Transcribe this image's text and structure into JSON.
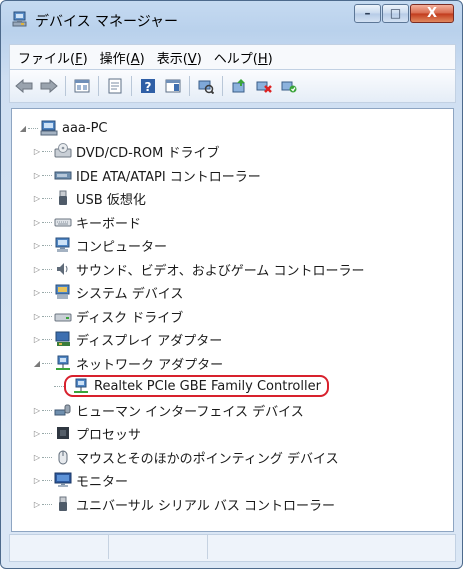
{
  "window": {
    "title": "デバイス マネージャー",
    "caption_buttons": {
      "minimize": "–",
      "maximize": "□",
      "close": "X"
    }
  },
  "menu": {
    "items": [
      {
        "text": "ファイル(",
        "key": "F",
        "end": ")"
      },
      {
        "text": "操作(",
        "key": "A",
        "end": ")"
      },
      {
        "text": "表示(",
        "key": "V",
        "end": ")"
      },
      {
        "text": "ヘルプ(",
        "key": "H",
        "end": ")"
      }
    ]
  },
  "toolbar": {
    "buttons": [
      "back-arrow-icon",
      "forward-arrow-icon",
      "properties-icon",
      "console-tree-icon",
      "help-icon",
      "action-pane-icon",
      "scan-hardware-icon",
      "update-driver-icon",
      "disable-device-icon",
      "uninstall-device-icon"
    ]
  },
  "tree": {
    "root": "aaa-PC",
    "items": [
      {
        "label": "DVD/CD-ROM ドライブ",
        "icon": "dvd-drive-icon",
        "expanded": false
      },
      {
        "label": "IDE ATA/ATAPI コントローラー",
        "icon": "ide-controller-icon",
        "expanded": false
      },
      {
        "label": "USB 仮想化",
        "icon": "usb-icon",
        "expanded": false
      },
      {
        "label": "キーボード",
        "icon": "keyboard-icon",
        "expanded": false
      },
      {
        "label": "コンピューター",
        "icon": "computer-icon",
        "expanded": false
      },
      {
        "label": "サウンド、ビデオ、およびゲーム コントローラー",
        "icon": "speaker-icon",
        "expanded": false
      },
      {
        "label": "システム デバイス",
        "icon": "system-device-icon",
        "expanded": false
      },
      {
        "label": "ディスク ドライブ",
        "icon": "disk-drive-icon",
        "expanded": false
      },
      {
        "label": "ディスプレイ アダプター",
        "icon": "display-adapter-icon",
        "expanded": false
      },
      {
        "label": "ネットワーク アダプター",
        "icon": "network-adapter-icon",
        "expanded": true
      },
      {
        "label": "ヒューマン インターフェイス デバイス",
        "icon": "hid-icon",
        "expanded": false
      },
      {
        "label": "プロセッサ",
        "icon": "processor-icon",
        "expanded": false
      },
      {
        "label": "マウスとそのほかのポインティング デバイス",
        "icon": "mouse-icon",
        "expanded": false
      },
      {
        "label": "モニター",
        "icon": "monitor-icon",
        "expanded": false
      },
      {
        "label": "ユニバーサル シリアル バス コントローラー",
        "icon": "usb-controller-icon",
        "expanded": false
      }
    ],
    "child": {
      "label": "Realtek PCIe GBE Family Controller",
      "icon": "network-card-icon"
    }
  }
}
